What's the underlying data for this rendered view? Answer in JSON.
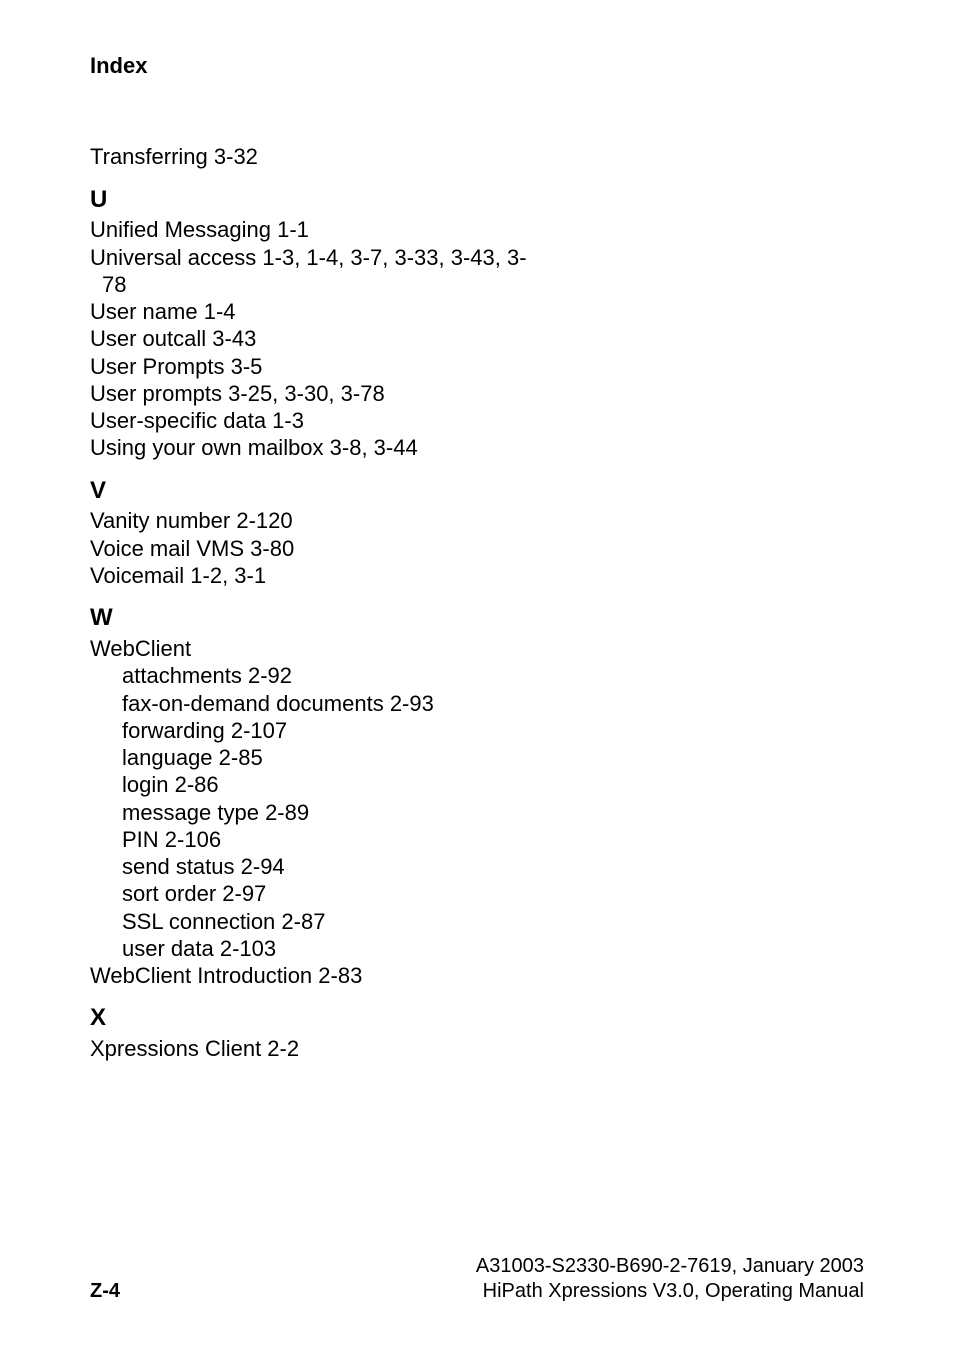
{
  "header": {
    "title": "Index"
  },
  "preEntries": [
    {
      "text": "Transferring  3-32"
    }
  ],
  "sections": [
    {
      "letter": "U",
      "entries": [
        {
          "text": "Unified Messaging  1-1"
        },
        {
          "text": "Universal access  1-3, 1-4, 3-7, 3-33, 3-43, 3-",
          "wrap": "78"
        },
        {
          "text": "User name  1-4"
        },
        {
          "text": "User outcall  3-43"
        },
        {
          "text": "User Prompts  3-5"
        },
        {
          "text": "User prompts  3-25, 3-30, 3-78"
        },
        {
          "text": "User-specific data  1-3"
        },
        {
          "text": "Using your own mailbox  3-8, 3-44"
        }
      ]
    },
    {
      "letter": "V",
      "entries": [
        {
          "text": "Vanity number  2-120"
        },
        {
          "text": "Voice mail VMS  3-80"
        },
        {
          "text": "Voicemail  1-2, 3-1"
        }
      ]
    },
    {
      "letter": "W",
      "entries": [
        {
          "text": "WebClient"
        },
        {
          "text": "attachments  2-92",
          "sub": true
        },
        {
          "text": "fax-on-demand documents  2-93",
          "sub": true
        },
        {
          "text": "forwarding  2-107",
          "sub": true
        },
        {
          "text": "language  2-85",
          "sub": true
        },
        {
          "text": "login  2-86",
          "sub": true
        },
        {
          "text": "message type  2-89",
          "sub": true
        },
        {
          "text": "PIN  2-106",
          "sub": true
        },
        {
          "text": "send status  2-94",
          "sub": true
        },
        {
          "text": "sort order  2-97",
          "sub": true
        },
        {
          "text": "SSL connection  2-87",
          "sub": true
        },
        {
          "text": "user data  2-103",
          "sub": true
        },
        {
          "text": "WebClient Introduction  2-83"
        }
      ]
    },
    {
      "letter": "X",
      "entries": [
        {
          "text": "Xpressions Client  2-2"
        }
      ]
    }
  ],
  "footer": {
    "pageNumber": "Z-4",
    "line1": "A31003-S2330-B690-2-7619, January 2003",
    "line2": "HiPath Xpressions V3.0, Operating Manual"
  }
}
